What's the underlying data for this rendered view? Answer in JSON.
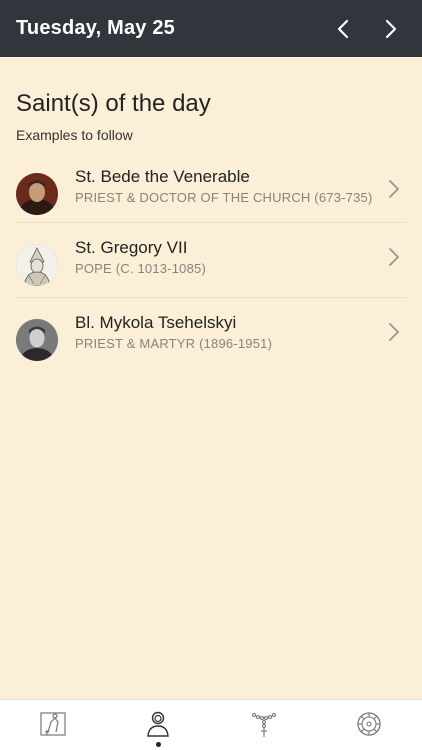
{
  "header": {
    "title": "Tuesday, May 25"
  },
  "main": {
    "section_title": "Saint(s) of the day",
    "section_subtitle": "Examples to follow",
    "saints": [
      {
        "name": "St. Bede the Venerable",
        "description": "PRIEST & DOCTOR OF THE CHURCH (673-735)"
      },
      {
        "name": "St. Gregory VII",
        "description": "POPE (C. 1013-1085)"
      },
      {
        "name": "Bl. Mykola Tsehelskyi",
        "description": "PRIEST & MARTYR (1896-1951)"
      }
    ]
  },
  "tabbar": {
    "tabs": [
      {
        "icon": "prayer-icon",
        "selected": false
      },
      {
        "icon": "saints-icon",
        "selected": true
      },
      {
        "icon": "rosary-icon",
        "selected": false
      },
      {
        "icon": "settings-icon",
        "selected": false
      }
    ]
  },
  "colors": {
    "header_bg": "#31363d",
    "page_bg": "#fcefd8",
    "description_text": "#8a8378"
  }
}
